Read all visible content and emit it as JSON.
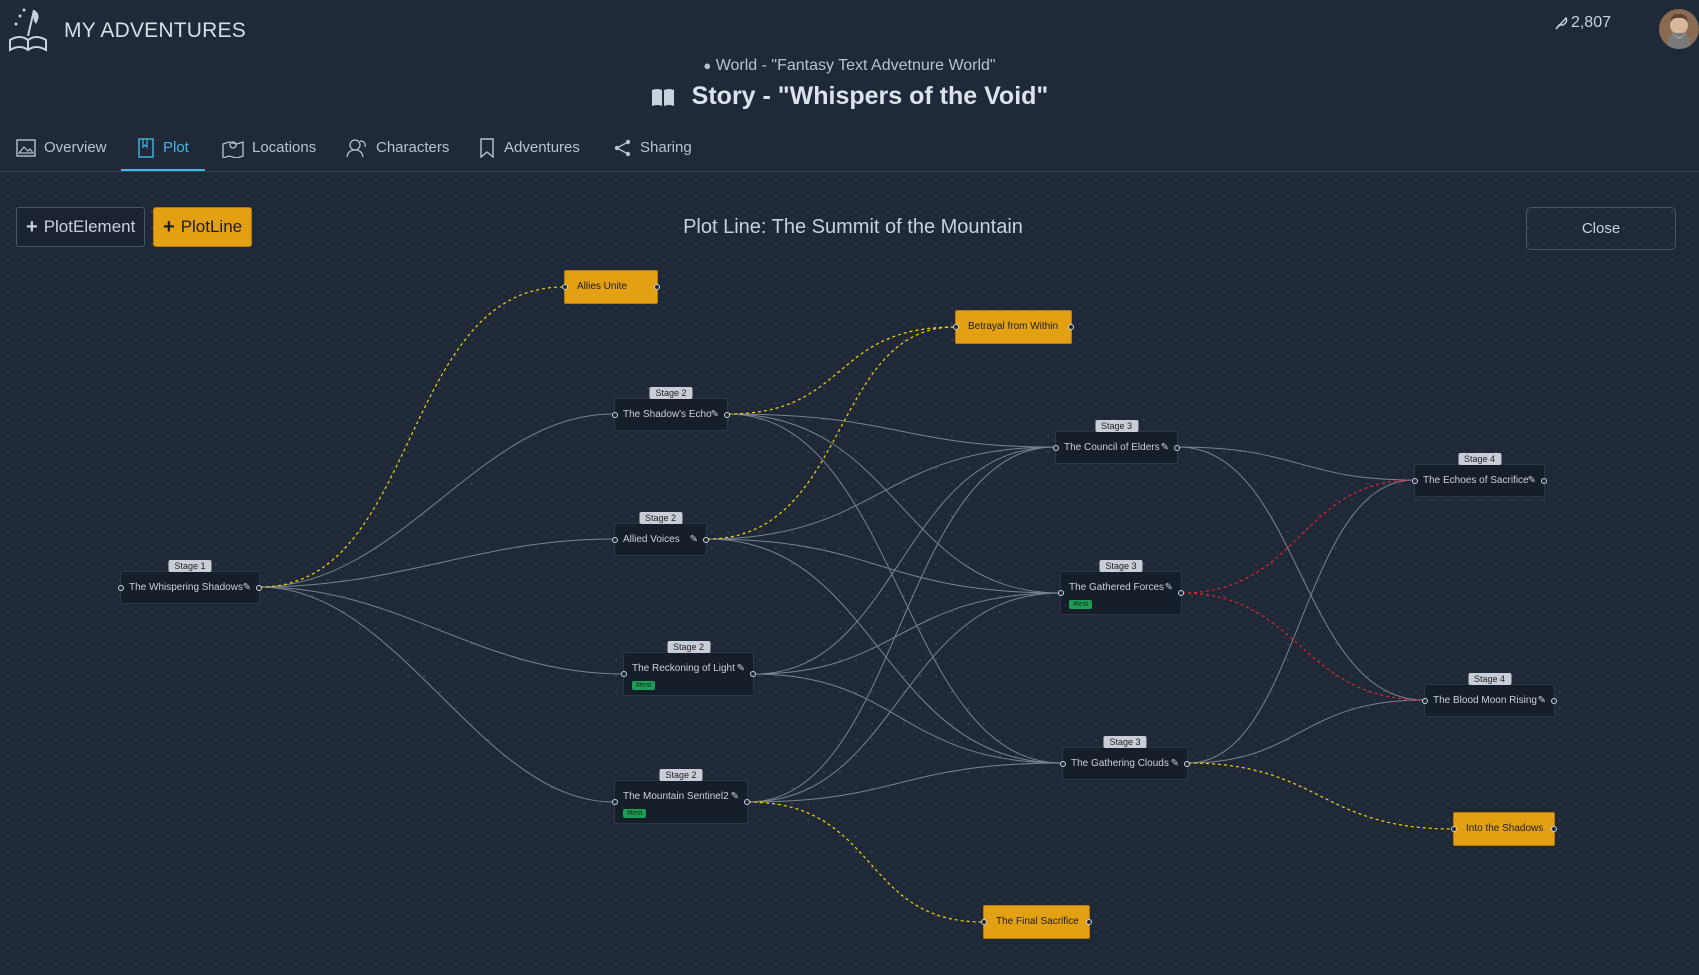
{
  "header": {
    "app_title": "MY ADVENTURES",
    "credits": "2,807",
    "world_label": "World - \"Fantasy Text Advetnure World\"",
    "story_label": "Story - \"Whispers of the Void\""
  },
  "tabs": [
    {
      "label": "Overview",
      "icon": "image-icon"
    },
    {
      "label": "Plot",
      "icon": "book-icon",
      "active": true
    },
    {
      "label": "Locations",
      "icon": "map-icon"
    },
    {
      "label": "Characters",
      "icon": "users-icon"
    },
    {
      "label": "Adventures",
      "icon": "bookmark-icon"
    },
    {
      "label": "Sharing",
      "icon": "share-icon"
    }
  ],
  "toolbar": {
    "plot_element_label": "PlotElement",
    "plot_line_label": "PlotLine",
    "close_label": "Close"
  },
  "plot_title": "Plot Line: The Summit of the Mountain",
  "nodes": [
    {
      "id": "n1",
      "stage": "Stage 1",
      "label": "The Whispering Shadows"
    },
    {
      "id": "n2",
      "stage": "Stage 2",
      "label": "The Shadow's Echo"
    },
    {
      "id": "n3",
      "stage": "Stage 2",
      "label": "Allied Voices"
    },
    {
      "id": "n4",
      "stage": "Stage 2",
      "label": "The Reckoning of Light",
      "tag": "#test"
    },
    {
      "id": "n5",
      "stage": "Stage 2",
      "label": "The Mountain Sentinel2",
      "tag": "#test"
    },
    {
      "id": "n6",
      "stage": "Stage 3",
      "label": "The Council of Elders"
    },
    {
      "id": "n7",
      "stage": "Stage 3",
      "label": "The Gathered Forces",
      "tag": "#test"
    },
    {
      "id": "n8",
      "stage": "Stage 3",
      "label": "The Gathering Clouds"
    },
    {
      "id": "n9",
      "stage": "Stage 4",
      "label": "The Echoes of Sacrifice"
    },
    {
      "id": "n10",
      "stage": "Stage 4",
      "label": "The Blood Moon Rising"
    }
  ],
  "events": [
    {
      "id": "e1",
      "label": "Allies Unite"
    },
    {
      "id": "e2",
      "label": "Betrayal from Within"
    },
    {
      "id": "e3",
      "label": "Into the Shadows"
    },
    {
      "id": "e4",
      "label": "The Final Sacrifice"
    }
  ],
  "colors": {
    "accent": "#3fb8e8",
    "event": "#e3a012",
    "edge": "#8a93a0",
    "edge_yellow": "#f5d20a",
    "edge_red": "#e02626",
    "tag": "#1f9d55"
  }
}
